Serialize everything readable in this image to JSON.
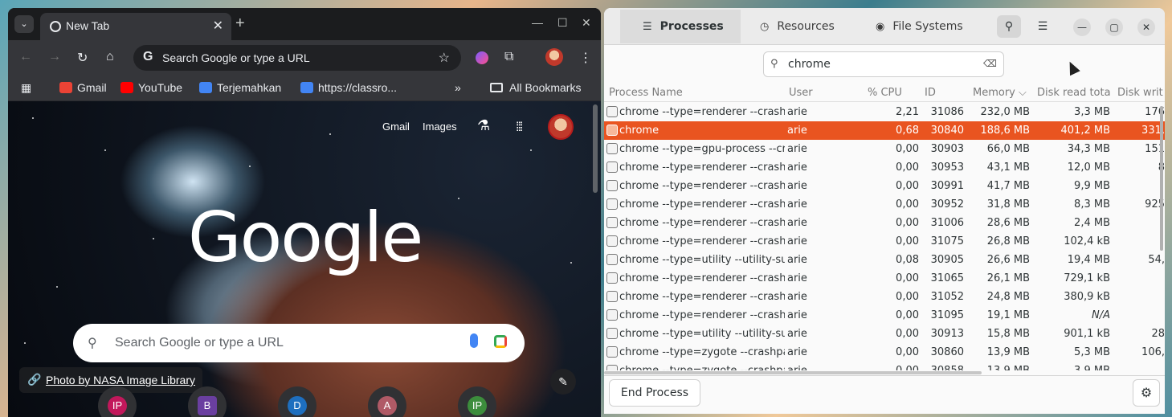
{
  "chrome": {
    "tab_search_glyph": "⌄",
    "tab_title": "New Tab",
    "tab_close": "✕",
    "new_tab": "+",
    "win_min": "—",
    "win_max": "☐",
    "win_close": "✕",
    "nav": {
      "back": "←",
      "forward": "→",
      "reload": "↻",
      "home": "⌂"
    },
    "omnibox": {
      "g": "G",
      "placeholder": "Search Google or type a URL",
      "star": "☆"
    },
    "ext_puzzle": "⧉",
    "menu_dots": "⋮",
    "bookmarks": [
      {
        "label": "Gmail",
        "color": "#ea4335"
      },
      {
        "label": "YouTube",
        "color": "#ff0000"
      },
      {
        "label": "Terjemahkan",
        "color": "#4285f4"
      },
      {
        "label": "https://classro...",
        "color": "#4285f4"
      }
    ],
    "bookmarks_more": "»",
    "all_bookmarks": "All Bookmarks",
    "ntp": {
      "gmail": "Gmail",
      "images": "Images",
      "labs": "⚗",
      "apps": "⁞⁞⁞",
      "logo": "Google",
      "search_glyph": "⚲",
      "search_placeholder": "Search Google or type a URL",
      "credit_link": "🔗",
      "credit": "Photo by NASA Image Library",
      "edit": "✎",
      "shortcuts": [
        {
          "label": "IP",
          "color": "#c2185b"
        },
        {
          "label": "B",
          "color": "#6a3fa0"
        },
        {
          "label": "D",
          "color": "#1e6fbf"
        },
        {
          "label": "A",
          "color": "#b05a66"
        },
        {
          "label": "IP",
          "color": "#3c8d3c"
        }
      ]
    }
  },
  "sysmon": {
    "tabs": [
      {
        "icon": "☰",
        "label": "Processes"
      },
      {
        "icon": "◷",
        "label": "Resources"
      },
      {
        "icon": "◉",
        "label": "File Systems"
      }
    ],
    "search_btn": "⚲",
    "menu_btn": "☰",
    "min": "—",
    "max": "▢",
    "close": "✕",
    "search_value": "chrome",
    "search_glyph": "⚲",
    "search_clear": "⌫",
    "columns": [
      "Process Name",
      "User",
      "% CPU",
      "ID",
      "Memory ⌵",
      "Disk read tota",
      "Disk writ"
    ],
    "rows": [
      {
        "name": "chrome --type=renderer --crash",
        "user": "arie",
        "cpu": "2,21",
        "id": "31086",
        "mem": "232,0 MB",
        "dread": "3,3 MB",
        "dwrite": "176"
      },
      {
        "name": "chrome",
        "user": "arie",
        "cpu": "0,68",
        "id": "30840",
        "mem": "188,6 MB",
        "dread": "401,2 MB",
        "dwrite": "331,"
      },
      {
        "name": "chrome --type=gpu-process --cr",
        "user": "arie",
        "cpu": "0,00",
        "id": "30903",
        "mem": "66,0 MB",
        "dread": "34,3 MB",
        "dwrite": "151"
      },
      {
        "name": "chrome --type=renderer --crash",
        "user": "arie",
        "cpu": "0,00",
        "id": "30953",
        "mem": "43,1 MB",
        "dread": "12,0 MB",
        "dwrite": "8"
      },
      {
        "name": "chrome --type=renderer --crash",
        "user": "arie",
        "cpu": "0,00",
        "id": "30991",
        "mem": "41,7 MB",
        "dread": "9,9 MB",
        "dwrite": ""
      },
      {
        "name": "chrome --type=renderer --crash",
        "user": "arie",
        "cpu": "0,00",
        "id": "30952",
        "mem": "31,8 MB",
        "dread": "8,3 MB",
        "dwrite": "925"
      },
      {
        "name": "chrome --type=renderer --crash",
        "user": "arie",
        "cpu": "0,00",
        "id": "31006",
        "mem": "28,6 MB",
        "dread": "2,4 MB",
        "dwrite": ""
      },
      {
        "name": "chrome --type=renderer --crash",
        "user": "arie",
        "cpu": "0,00",
        "id": "31075",
        "mem": "26,8 MB",
        "dread": "102,4 kB",
        "dwrite": ""
      },
      {
        "name": "chrome --type=utility --utility-su",
        "user": "arie",
        "cpu": "0,08",
        "id": "30905",
        "mem": "26,6 MB",
        "dread": "19,4 MB",
        "dwrite": "54,"
      },
      {
        "name": "chrome --type=renderer --crash",
        "user": "arie",
        "cpu": "0,00",
        "id": "31065",
        "mem": "26,1 MB",
        "dread": "729,1 kB",
        "dwrite": ""
      },
      {
        "name": "chrome --type=renderer --crash",
        "user": "arie",
        "cpu": "0,00",
        "id": "31052",
        "mem": "24,8 MB",
        "dread": "380,9 kB",
        "dwrite": ""
      },
      {
        "name": "chrome --type=renderer --crash",
        "user": "arie",
        "cpu": "0,00",
        "id": "31095",
        "mem": "19,1 MB",
        "dread": "N/A",
        "dwrite": ""
      },
      {
        "name": "chrome --type=utility --utility-su",
        "user": "arie",
        "cpu": "0,00",
        "id": "30913",
        "mem": "15,8 MB",
        "dread": "901,1 kB",
        "dwrite": "28"
      },
      {
        "name": "chrome --type=zygote --crashpa",
        "user": "arie",
        "cpu": "0,00",
        "id": "30860",
        "mem": "13,9 MB",
        "dread": "5,3 MB",
        "dwrite": "106,"
      },
      {
        "name": "chrome --type=zygote --crashpa",
        "user": "arie",
        "cpu": "0,00",
        "id": "30858",
        "mem": "13,9 MB",
        "dread": "3,9 MB",
        "dwrite": ""
      }
    ],
    "selected_index": 1,
    "end_process": "End Process",
    "gear": "⚙",
    "accent": "#e95420"
  }
}
